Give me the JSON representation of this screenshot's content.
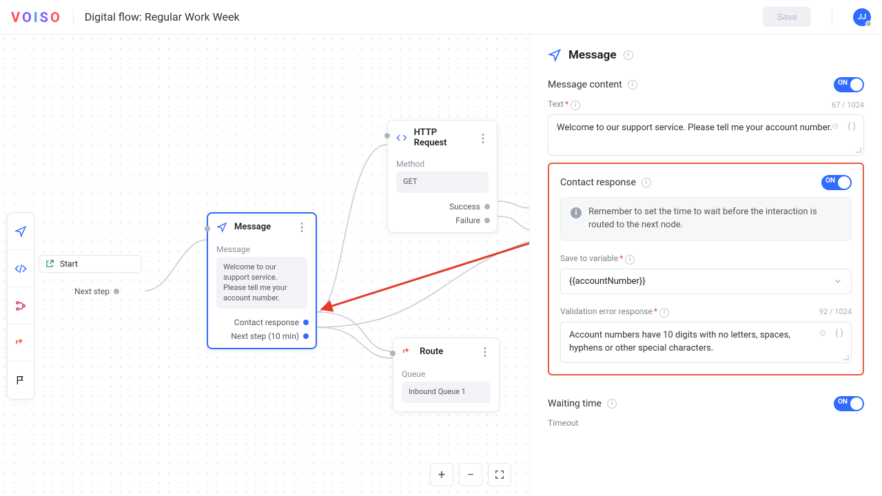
{
  "header": {
    "logo_letters": [
      "V",
      "O",
      "I",
      "S",
      "O"
    ],
    "page_title": "Digital flow: Regular Work Week",
    "save_label": "Save",
    "avatar_initials": "JJ"
  },
  "toolbar_icons": [
    "send-icon",
    "code-icon",
    "branch-icon",
    "redirect-icon",
    "flag-icon"
  ],
  "nodes": {
    "start": {
      "label": "Start",
      "port": "Next step"
    },
    "message": {
      "title": "Message",
      "section_label": "Message",
      "text": "Welcome to our support service. Please tell me your account number.",
      "ports": [
        "Contact response",
        "Next step (10 min)"
      ]
    },
    "http": {
      "title": "HTTP Request",
      "section_label": "Method",
      "method": "GET",
      "ports": [
        "Success",
        "Failure"
      ]
    },
    "route": {
      "title": "Route",
      "section_label": "Queue",
      "queue": "Inbound Queue 1"
    }
  },
  "zoom": {
    "plus": "+",
    "minus": "−",
    "fit": "⛶"
  },
  "panel": {
    "title": "Message",
    "message_content": {
      "heading": "Message content",
      "toggle": "ON",
      "text_label": "Text",
      "text_value": "Welcome to our support service. Please tell me your account number.",
      "text_counter": "67 / 1024"
    },
    "contact_response": {
      "heading": "Contact response",
      "toggle": "ON",
      "notice": "Remember to set the time to wait before the interaction is routed to the next node.",
      "save_var_label": "Save to variable",
      "save_var_value": "{{accountNumber}}",
      "validation_label": "Validation error response",
      "validation_value": "Account numbers have 10 digits with no letters, spaces, hyphens or other special characters.",
      "validation_counter": "92 / 1024"
    },
    "waiting_time": {
      "heading": "Waiting time",
      "toggle": "ON",
      "timeout_label": "Timeout"
    }
  }
}
